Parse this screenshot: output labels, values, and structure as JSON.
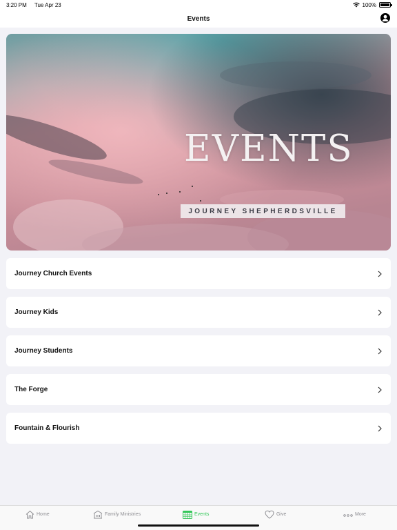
{
  "status_bar": {
    "time": "3:20 PM",
    "date": "Tue Apr 23",
    "battery_text": "100%",
    "battery_level": 1.0
  },
  "nav": {
    "title": "Events",
    "profile_icon": "person-circle-icon"
  },
  "hero": {
    "title": "EVENTS",
    "subtitle": "JOURNEY SHEPHERDSVILLE"
  },
  "events": [
    {
      "label": "Journey Church Events"
    },
    {
      "label": "Journey Kids"
    },
    {
      "label": "Journey Students"
    },
    {
      "label": "The Forge"
    },
    {
      "label": "Fountain & Flourish"
    }
  ],
  "tabs": [
    {
      "label": "Home",
      "icon": "house-icon"
    },
    {
      "label": "Family Ministries",
      "icon": "building-icon"
    },
    {
      "label": "Events",
      "icon": "calendar-icon",
      "active": true
    },
    {
      "label": "Give",
      "icon": "heart-icon"
    },
    {
      "label": "More",
      "icon": "ellipsis-icon"
    }
  ],
  "colors": {
    "accent": "#34c759",
    "inactive": "#8e8e93",
    "background": "#f2f2f7"
  }
}
